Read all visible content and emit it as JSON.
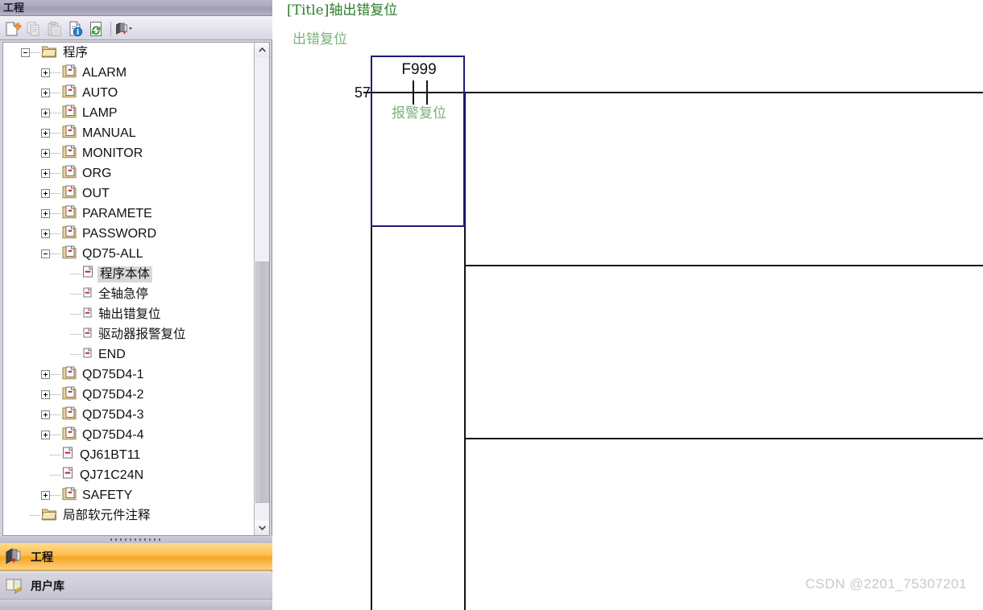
{
  "panel": {
    "title": "工程",
    "toolbar": {
      "buttons": [
        {
          "name": "new-project-icon",
          "label": "新建",
          "enabled": true
        },
        {
          "name": "copy-icon",
          "label": "复制",
          "enabled": false
        },
        {
          "name": "paste-icon",
          "label": "粘贴",
          "enabled": false
        },
        {
          "name": "property-info-icon",
          "label": "属性",
          "enabled": true
        },
        {
          "name": "refresh-icon",
          "label": "刷新",
          "enabled": true
        },
        {
          "name": "plc-module-icon",
          "label": "PLC参数",
          "enabled": true
        }
      ]
    },
    "tree": {
      "root": "程序",
      "items": [
        {
          "label": "ALARM",
          "level": 1,
          "expander": "plus",
          "icon": "program-file-icon",
          "selected": false
        },
        {
          "label": "AUTO",
          "level": 1,
          "expander": "plus",
          "icon": "program-file-icon",
          "selected": false
        },
        {
          "label": "LAMP",
          "level": 1,
          "expander": "plus",
          "icon": "program-file-icon",
          "selected": false
        },
        {
          "label": "MANUAL",
          "level": 1,
          "expander": "plus",
          "icon": "program-file-icon",
          "selected": false
        },
        {
          "label": "MONITOR",
          "level": 1,
          "expander": "plus",
          "icon": "program-file-icon",
          "selected": false
        },
        {
          "label": "ORG",
          "level": 1,
          "expander": "plus",
          "icon": "program-file-icon",
          "selected": false
        },
        {
          "label": "OUT",
          "level": 1,
          "expander": "plus",
          "icon": "program-file-icon",
          "selected": false
        },
        {
          "label": "PARAMETE",
          "level": 1,
          "expander": "plus",
          "icon": "program-file-icon",
          "selected": false
        },
        {
          "label": "PASSWORD",
          "level": 1,
          "expander": "plus",
          "icon": "program-file-icon",
          "selected": false
        },
        {
          "label": "QD75-ALL",
          "level": 1,
          "expander": "minus",
          "icon": "program-file-icon",
          "selected": false
        },
        {
          "label": "程序本体",
          "level": 2,
          "expander": "none",
          "icon": "ladder-body-icon",
          "selected": true,
          "cjk": true
        },
        {
          "label": "全轴急停",
          "level": 2,
          "expander": "none",
          "icon": "pointer-file-icon",
          "selected": false,
          "cjk": true
        },
        {
          "label": "轴出错复位",
          "level": 2,
          "expander": "none",
          "icon": "pointer-file-icon",
          "selected": false,
          "cjk": true
        },
        {
          "label": "驱动器报警复位",
          "level": 2,
          "expander": "none",
          "icon": "pointer-file-icon",
          "selected": false,
          "cjk": true
        },
        {
          "label": "END",
          "level": 2,
          "expander": "none",
          "icon": "pointer-file-icon",
          "selected": false
        },
        {
          "label": "QD75D4-1",
          "level": 1,
          "expander": "plus",
          "icon": "program-file-icon",
          "selected": false
        },
        {
          "label": "QD75D4-2",
          "level": 1,
          "expander": "plus",
          "icon": "program-file-icon",
          "selected": false
        },
        {
          "label": "QD75D4-3",
          "level": 1,
          "expander": "plus",
          "icon": "program-file-icon",
          "selected": false
        },
        {
          "label": "QD75D4-4",
          "level": 1,
          "expander": "plus",
          "icon": "program-file-icon",
          "selected": false
        },
        {
          "label": "QJ61BT11",
          "level": 1,
          "expander": "none",
          "icon": "ladder-body-icon",
          "selected": false
        },
        {
          "label": "QJ71C24N",
          "level": 1,
          "expander": "none",
          "icon": "ladder-body-icon",
          "selected": false
        },
        {
          "label": "SAFETY",
          "level": 1,
          "expander": "plus",
          "icon": "program-file-icon",
          "selected": false
        },
        {
          "label": "局部软元件注释",
          "level": 0,
          "expander": "none",
          "icon": "folder-icon",
          "selected": false,
          "cjk": true
        }
      ]
    },
    "nav_buttons": [
      {
        "label": "工程",
        "icon": "project-nav-icon",
        "selected": true
      },
      {
        "label": "用户库",
        "icon": "userlib-nav-icon",
        "selected": false
      }
    ]
  },
  "ladder": {
    "title": "[Title]轴出错复位",
    "subtitle": "出错复位",
    "rung_number": "57",
    "contact": {
      "device": "F999",
      "comment": "报警复位",
      "type": "normally-open"
    },
    "watermark": "CSDN @2201_75307201"
  },
  "colors": {
    "title_green": "#2b7d2b",
    "comment_green": "#7bb27b",
    "selection_navy": "#1b1b7a",
    "nav_selected_orange": "#f5a623",
    "grid_black": "#141414"
  }
}
